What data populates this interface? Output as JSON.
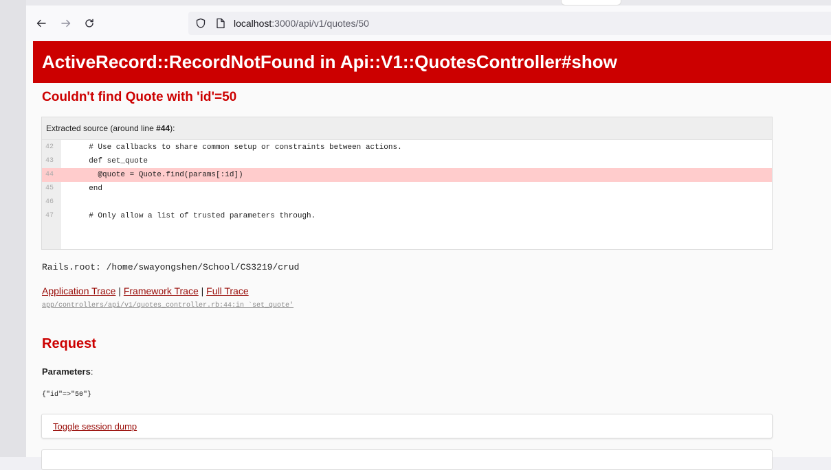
{
  "browser": {
    "url_host": "localhost",
    "url_rest": ":3000/api/v1/quotes/50",
    "icons": [
      "back-arrow-icon",
      "forward-arrow-icon",
      "reload-icon",
      "shield-icon",
      "page-icon"
    ]
  },
  "error": {
    "title": "ActiveRecord::RecordNotFound in Api::V1::QuotesController#show",
    "message": "Couldn't find Quote with 'id'=50"
  },
  "source": {
    "header_prefix": "Extracted source (around line ",
    "header_line": "#44",
    "header_suffix": "):",
    "lines": [
      {
        "num": "42",
        "code": "  # Use callbacks to share common setup or constraints between actions."
      },
      {
        "num": "43",
        "code": "  def set_quote"
      },
      {
        "num": "44",
        "code": "    @quote = Quote.find(params[:id])"
      },
      {
        "num": "45",
        "code": "  end"
      },
      {
        "num": "46",
        "code": ""
      },
      {
        "num": "47",
        "code": "  # Only allow a list of trusted parameters through."
      }
    ],
    "highlight_line": "44"
  },
  "rails_root": "Rails.root: /home/swayongshen/School/CS3219/crud",
  "traces": {
    "application": "Application Trace",
    "framework": "Framework Trace",
    "full": "Full Trace",
    "separator": " | ",
    "line": "app/controllers/api/v1/quotes_controller.rb:44:in `set_quote'"
  },
  "request": {
    "heading": "Request",
    "params_label": "Parameters",
    "params_colon": ":",
    "params_value": "{\"id\"=>\"50\"}",
    "toggle_session": "Toggle session dump"
  },
  "colors": {
    "error_red": "#cc0000",
    "link": "#980905",
    "highlight": "#ffcccc"
  }
}
